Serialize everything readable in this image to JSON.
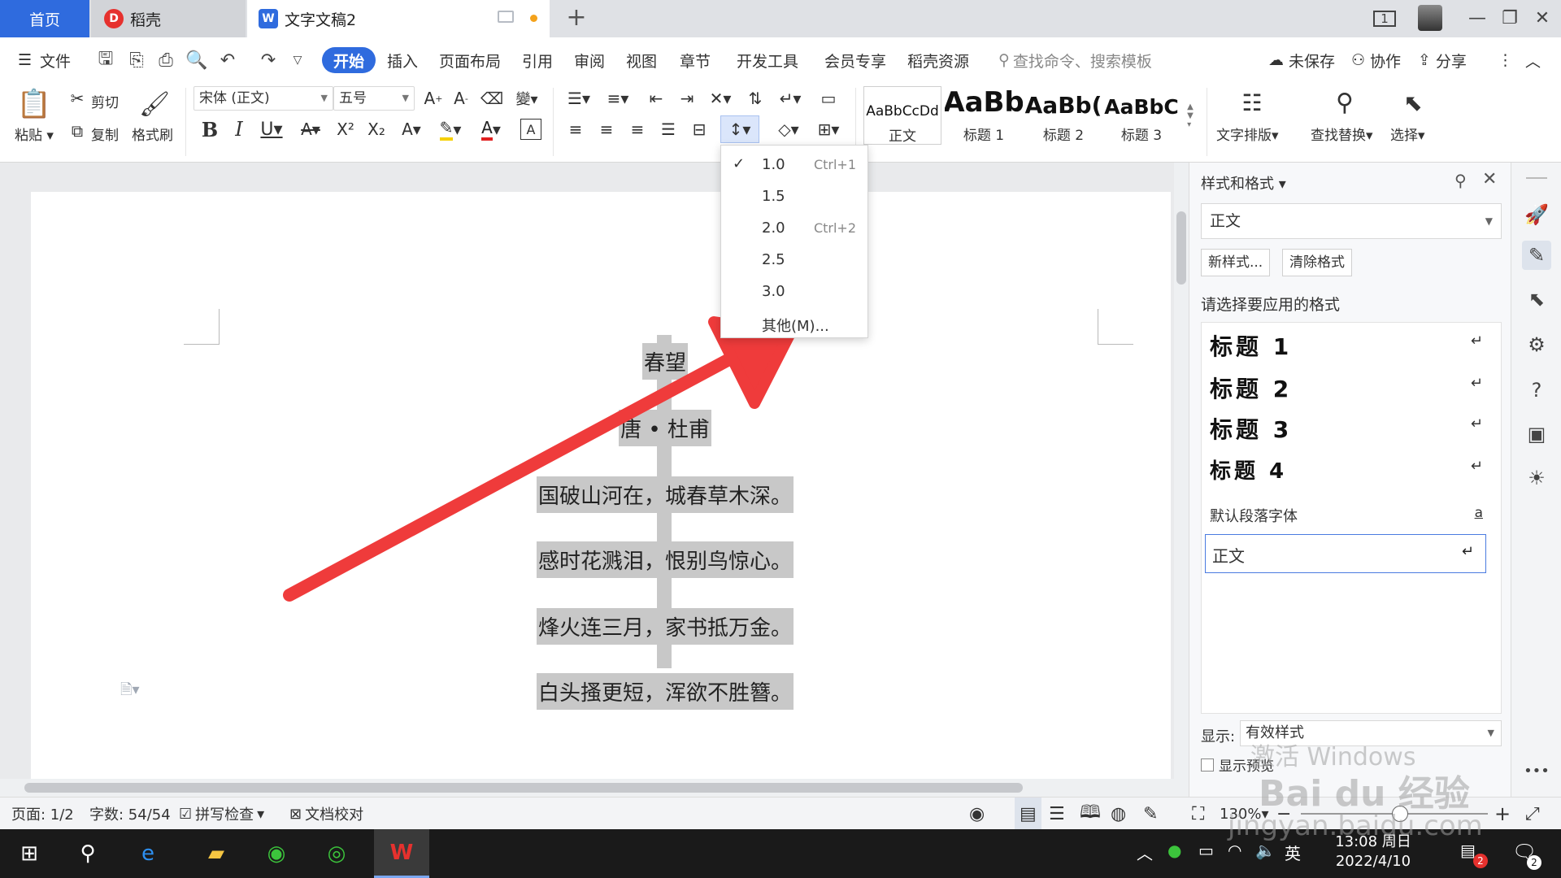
{
  "tabs": {
    "home": "首页",
    "daoke": "稻壳",
    "doc": "文字文稿2",
    "add": "+"
  },
  "window": {
    "layout_btn": "1",
    "minimize": "—",
    "restore": "❐",
    "close": "✕"
  },
  "menu": {
    "file": "文件",
    "items": [
      "开始",
      "插入",
      "页面布局",
      "引用",
      "审阅",
      "视图",
      "章节",
      "开发工具",
      "会员专享",
      "稻壳资源"
    ],
    "search_placeholder": "查找命令、搜索模板",
    "unsaved": "未保存",
    "collab": "协作",
    "share": "分享"
  },
  "ribbon": {
    "paste": "粘贴",
    "cut": "剪切",
    "copy": "复制",
    "format_painter": "格式刷",
    "font_name": "宋体 (正文)",
    "font_size": "五号",
    "styles": [
      {
        "sample": "AaBbCcDd",
        "name": "正文"
      },
      {
        "sample": "AaBb",
        "name": "标题 1"
      },
      {
        "sample": "AaBb(",
        "name": "标题 2"
      },
      {
        "sample": "AaBbC",
        "name": "标题 3"
      }
    ],
    "text_layout": "文字排版",
    "find_replace": "查找替换",
    "select": "选择"
  },
  "line_spacing_menu": {
    "items": [
      {
        "value": "1.0",
        "shortcut": "Ctrl+1",
        "checked": true
      },
      {
        "value": "1.5",
        "shortcut": "",
        "checked": false
      },
      {
        "value": "2.0",
        "shortcut": "Ctrl+2",
        "checked": false
      },
      {
        "value": "2.5",
        "shortcut": "",
        "checked": false
      },
      {
        "value": "3.0",
        "shortcut": "",
        "checked": false
      }
    ],
    "other": "其他(M)..."
  },
  "document": {
    "lines": [
      "春望",
      "唐 • 杜甫",
      "国破山河在，城春草木深。",
      "感时花溅泪，恨别鸟惊心。",
      "烽火连三月，家书抵万金。",
      "白头搔更短，浑欲不胜簪。"
    ]
  },
  "pane": {
    "title": "样式和格式",
    "current_style": "正文",
    "new_style": "新样式...",
    "clear_format": "清除格式",
    "prompt": "请选择要应用的格式",
    "styles": [
      "标题 1",
      "标题 2",
      "标题 3",
      "标题 4"
    ],
    "default_font": "默认段落字体",
    "default_font_mark": "a",
    "normal": "正文",
    "show_label": "显示:",
    "show_value": "有效样式",
    "preview": "显示预览"
  },
  "status": {
    "page": "页面: 1/2",
    "words": "字数: 54/54",
    "spell": "拼写检查",
    "proof": "文档校对",
    "zoom": "130%"
  },
  "taskbar": {
    "ime": "英",
    "time": "13:08 周日",
    "date": "2022/4/10",
    "notify": "2"
  },
  "watermark": {
    "line1": "激活 Windows",
    "line2": "Bai du 经验",
    "line3": "jingyan.baidu.com"
  },
  "colors": {
    "accent": "#2f6bde",
    "arrow": "#ef3b3b",
    "highlight": "#c8c8c8"
  }
}
